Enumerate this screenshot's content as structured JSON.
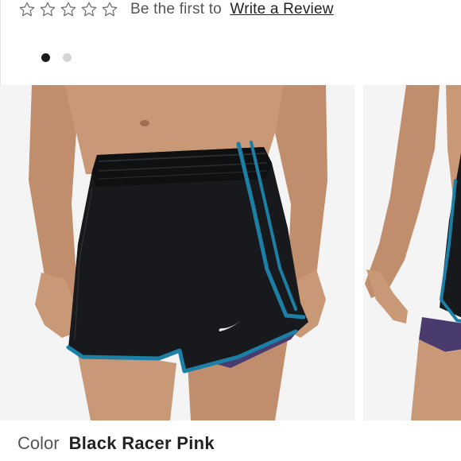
{
  "review": {
    "star_count": 5,
    "rating": 0,
    "prompt": "Be the first to",
    "link_text": "Write a Review"
  },
  "carousel": {
    "slide_count": 2,
    "active_index": 0,
    "brand_mark": "swoosh-logo"
  },
  "product": {
    "color_label": "Color",
    "color_value": "Black Racer Pink"
  },
  "colors": {
    "shorts": "#17191c",
    "trim": "#1b7fa6",
    "liner": "#4a3b6e",
    "skin": "#c89877",
    "dot_active": "#1a1a1a",
    "dot_inactive": "#d6d6d6"
  }
}
